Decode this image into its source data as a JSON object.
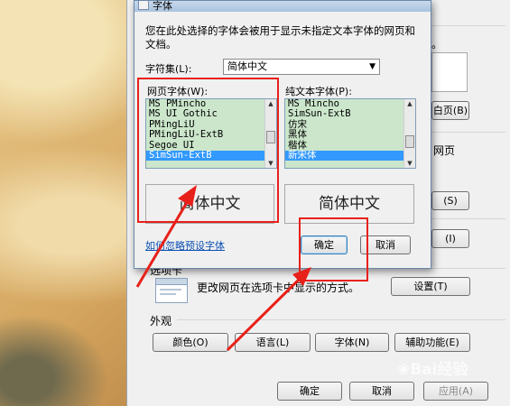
{
  "background_dialog": {
    "right_fragments": {
      "dot_text": "。",
      "home_button": "白页(B)",
      "web_text": "网页",
      "s_button": "(S)",
      "t_button": "(I)"
    },
    "tabs_section": {
      "title": "选项卡",
      "description": "更改网页在选项卡中显示的方式。",
      "settings_button": "设置(T)"
    },
    "appearance_section": {
      "title": "外观",
      "buttons": [
        "颜色(O)",
        "语言(L)",
        "字体(N)",
        "辅助功能(E)"
      ]
    },
    "footer": {
      "ok": "确定",
      "cancel": "取消",
      "apply": "应用(A)"
    }
  },
  "font_dialog": {
    "title": "字体",
    "description": "您在此处选择的字体会被用于显示未指定文本字体的网页和文档。",
    "charset_label": "字符集(L):",
    "charset_value": "简体中文",
    "web_font_label": "网页字体(W):",
    "web_fonts": [
      "MS PMincho",
      "MS UI Gothic",
      "PMingLiU",
      "PMingLiU-ExtB",
      "Segoe UI",
      "SimSun-ExtB"
    ],
    "web_font_selected": "SimSun-ExtB",
    "plain_font_label": "纯文本字体(P):",
    "plain_fonts": [
      "MS Mincho",
      "SimSun-ExtB",
      "仿宋",
      "黑体",
      "楷体",
      "新宋体"
    ],
    "plain_font_selected": "新宋体",
    "preview_left": "简体中文",
    "preview_right": "简体中文",
    "ignore_link": "如何忽略预设字体",
    "ok": "确定",
    "cancel": "取消"
  },
  "annotation_color": "#e8201a",
  "watermark": "Bai经验"
}
